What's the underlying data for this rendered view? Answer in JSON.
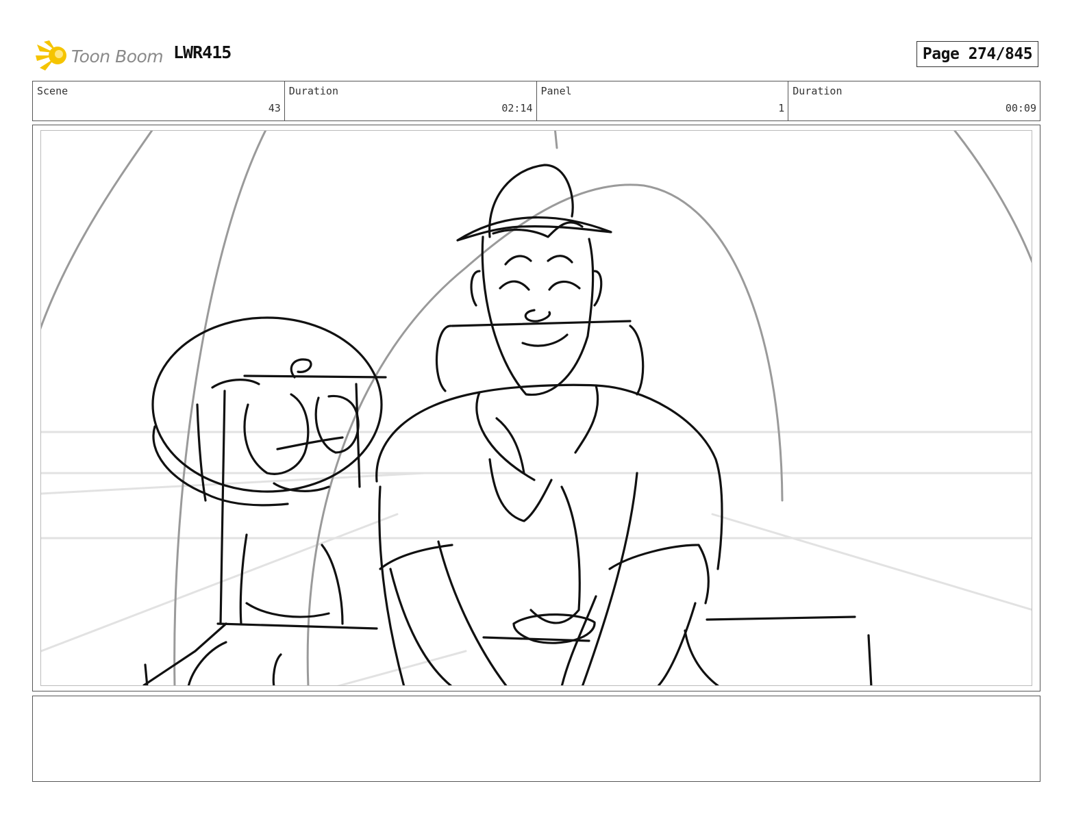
{
  "header": {
    "brand_name": "Toon Boom",
    "logo_icon": "toon-boom-logo-icon",
    "project_code": "LWR415",
    "page_label": "Page 274/845"
  },
  "info_bar": {
    "scene_label": "Scene",
    "scene_value": "43",
    "scene_duration_label": "Duration",
    "scene_duration_value": "02:14",
    "panel_label": "Panel",
    "panel_value": "1",
    "panel_duration_label": "Duration",
    "panel_duration_value": "00:09"
  },
  "panel": {
    "sketch": "storyboard-sketch-image"
  },
  "notes": {
    "text": ""
  },
  "colors": {
    "logo_yellow": "#f5c400",
    "logo_text": "#8a8a8a",
    "border": "#555555",
    "sketch_line": "#111111",
    "sketch_guide": "#9a9a9a"
  }
}
